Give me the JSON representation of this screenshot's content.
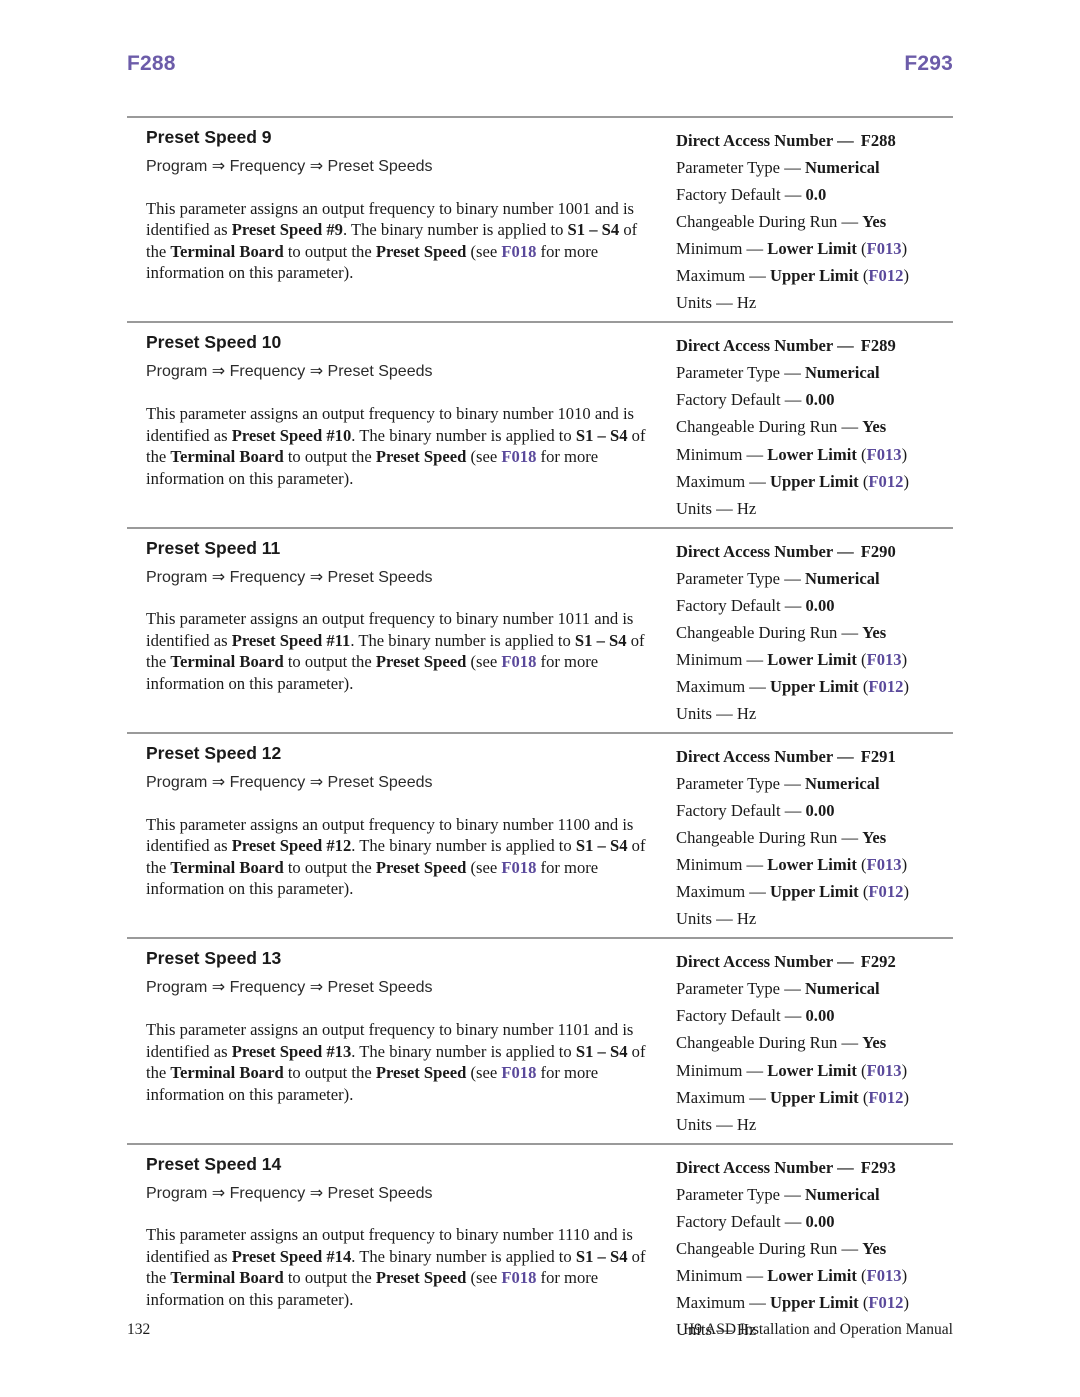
{
  "running_head": {
    "left": "F288",
    "right": "F293",
    "color": "#6c5ca9"
  },
  "accent_colors": {
    "running_head_purple": "#6c5ca9",
    "cross_reference_purple": "#5a499b",
    "rule_gray": "#9a9a9a"
  },
  "parameters": [
    {
      "title": "Preset Speed 9",
      "breadcrumb": "Program ⇒ Frequency ⇒ Preset Speeds",
      "desc_parts": [
        {
          "t": "This parameter assigns an output frequency to binary number 1001 and is identified as ",
          "s": "n"
        },
        {
          "t": "Preset Speed #9",
          "s": "b"
        },
        {
          "t": ". The binary number is applied to ",
          "s": "n"
        },
        {
          "t": "S1 – S4",
          "s": "b"
        },
        {
          "t": " of the ",
          "s": "n"
        },
        {
          "t": "Terminal Board",
          "s": "b"
        },
        {
          "t": " to output the ",
          "s": "n"
        },
        {
          "t": "Preset Speed",
          "s": "b"
        },
        {
          "t": " (see ",
          "s": "n"
        },
        {
          "t": "F018",
          "s": "r"
        },
        {
          "t": " for more information on this parameter).",
          "s": "n"
        }
      ],
      "specs": [
        {
          "label": "Direct Access Number —",
          "value": "F288",
          "bold_all": true,
          "gap": true
        },
        {
          "label": "Parameter Type —",
          "value": "Numerical"
        },
        {
          "label": "Factory Default —",
          "value": "0.0"
        },
        {
          "label": "Changeable During Run —",
          "value": "Yes"
        },
        {
          "label": "Minimum —",
          "value": "Lower Limit",
          "xref": "F013"
        },
        {
          "label": "Maximum —",
          "value": "Upper Limit",
          "xref": "F012"
        },
        {
          "label": "Units — Hz",
          "value": ""
        }
      ]
    },
    {
      "title": "Preset Speed 10",
      "breadcrumb": "Program ⇒ Frequency ⇒ Preset Speeds",
      "desc_parts": [
        {
          "t": "This parameter assigns an output frequency to binary number 1010 and is identified as ",
          "s": "n"
        },
        {
          "t": "Preset Speed #10",
          "s": "b"
        },
        {
          "t": ". The binary number is applied to ",
          "s": "n"
        },
        {
          "t": "S1 – S4",
          "s": "b"
        },
        {
          "t": " of the ",
          "s": "n"
        },
        {
          "t": "Terminal Board",
          "s": "b"
        },
        {
          "t": " to output the ",
          "s": "n"
        },
        {
          "t": "Preset Speed",
          "s": "b"
        },
        {
          "t": " (see ",
          "s": "n"
        },
        {
          "t": "F018",
          "s": "r"
        },
        {
          "t": " for more information on this parameter).",
          "s": "n"
        }
      ],
      "specs": [
        {
          "label": "Direct Access Number —",
          "value": "F289",
          "bold_all": true,
          "gap": true
        },
        {
          "label": "Parameter Type —",
          "value": "Numerical"
        },
        {
          "label": "Factory Default —",
          "value": "0.00"
        },
        {
          "label": "Changeable During Run —",
          "value": "Yes"
        },
        {
          "label": "Minimum —",
          "value": "Lower Limit",
          "xref": "F013"
        },
        {
          "label": "Maximum —",
          "value": "Upper Limit",
          "xref": "F012"
        },
        {
          "label": "Units — Hz",
          "value": ""
        }
      ]
    },
    {
      "title": "Preset Speed 11",
      "breadcrumb": "Program ⇒ Frequency ⇒ Preset Speeds",
      "desc_parts": [
        {
          "t": "This parameter assigns an output frequency to binary number 1011 and is identified as ",
          "s": "n"
        },
        {
          "t": "Preset Speed #11",
          "s": "b"
        },
        {
          "t": ". The binary number is applied to ",
          "s": "n"
        },
        {
          "t": "S1 – S4",
          "s": "b"
        },
        {
          "t": " of the ",
          "s": "n"
        },
        {
          "t": "Terminal Board",
          "s": "b"
        },
        {
          "t": " to output the ",
          "s": "n"
        },
        {
          "t": "Preset Speed",
          "s": "b"
        },
        {
          "t": " (see ",
          "s": "n"
        },
        {
          "t": "F018",
          "s": "r"
        },
        {
          "t": " for more information on this parameter).",
          "s": "n"
        }
      ],
      "specs": [
        {
          "label": "Direct Access Number —",
          "value": "F290",
          "bold_all": true,
          "gap": true
        },
        {
          "label": "Parameter Type —",
          "value": "Numerical"
        },
        {
          "label": "Factory Default —",
          "value": "0.00"
        },
        {
          "label": "Changeable During Run —",
          "value": "Yes"
        },
        {
          "label": "Minimum —",
          "value": "Lower Limit",
          "xref": "F013"
        },
        {
          "label": "Maximum —",
          "value": "Upper Limit",
          "xref": "F012"
        },
        {
          "label": "Units — Hz",
          "value": ""
        }
      ]
    },
    {
      "title": "Preset Speed 12",
      "breadcrumb": "Program ⇒ Frequency ⇒ Preset Speeds",
      "desc_parts": [
        {
          "t": "This parameter assigns an output frequency to binary number 1100 and is identified as ",
          "s": "n"
        },
        {
          "t": "Preset Speed #12",
          "s": "b"
        },
        {
          "t": ". The binary number is applied to ",
          "s": "n"
        },
        {
          "t": "S1 – S4",
          "s": "b"
        },
        {
          "t": " of the ",
          "s": "n"
        },
        {
          "t": "Terminal Board",
          "s": "b"
        },
        {
          "t": " to output the ",
          "s": "n"
        },
        {
          "t": "Preset Speed",
          "s": "b"
        },
        {
          "t": " (see ",
          "s": "n"
        },
        {
          "t": "F018",
          "s": "r"
        },
        {
          "t": " for more information on this parameter).",
          "s": "n"
        }
      ],
      "specs": [
        {
          "label": "Direct Access Number —",
          "value": "F291",
          "bold_all": true,
          "gap": true
        },
        {
          "label": "Parameter Type —",
          "value": "Numerical"
        },
        {
          "label": "Factory Default —",
          "value": "0.00"
        },
        {
          "label": "Changeable During Run —",
          "value": "Yes"
        },
        {
          "label": "Minimum —",
          "value": "Lower Limit",
          "xref": "F013"
        },
        {
          "label": "Maximum —",
          "value": "Upper Limit",
          "xref": "F012"
        },
        {
          "label": "Units — Hz",
          "value": ""
        }
      ]
    },
    {
      "title": "Preset Speed 13",
      "breadcrumb": "Program ⇒ Frequency ⇒ Preset Speeds",
      "desc_parts": [
        {
          "t": "This parameter assigns an output frequency to binary number 1101 and is identified as ",
          "s": "n"
        },
        {
          "t": "Preset Speed #13",
          "s": "b"
        },
        {
          "t": ". The binary number is applied to ",
          "s": "n"
        },
        {
          "t": "S1 – S4",
          "s": "b"
        },
        {
          "t": " of the ",
          "s": "n"
        },
        {
          "t": "Terminal Board",
          "s": "b"
        },
        {
          "t": " to output the ",
          "s": "n"
        },
        {
          "t": "Preset Speed",
          "s": "b"
        },
        {
          "t": " (see ",
          "s": "n"
        },
        {
          "t": "F018",
          "s": "r"
        },
        {
          "t": " for more information on this parameter).",
          "s": "n"
        }
      ],
      "specs": [
        {
          "label": "Direct Access Number —",
          "value": "F292",
          "bold_all": true,
          "gap": true
        },
        {
          "label": "Parameter Type —",
          "value": "Numerical"
        },
        {
          "label": "Factory Default —",
          "value": "0.00"
        },
        {
          "label": "Changeable During Run —",
          "value": "Yes"
        },
        {
          "label": "Minimum —",
          "value": "Lower Limit",
          "xref": "F013"
        },
        {
          "label": "Maximum —",
          "value": "Upper Limit",
          "xref": "F012"
        },
        {
          "label": "Units — Hz",
          "value": ""
        }
      ]
    },
    {
      "title": "Preset Speed 14",
      "breadcrumb": "Program ⇒ Frequency ⇒ Preset Speeds",
      "desc_parts": [
        {
          "t": "This parameter assigns an output frequency to binary number 1110 and is identified as ",
          "s": "n"
        },
        {
          "t": "Preset Speed #14",
          "s": "b"
        },
        {
          "t": ". The binary number is applied to ",
          "s": "n"
        },
        {
          "t": "S1 – S4",
          "s": "b"
        },
        {
          "t": " of the ",
          "s": "n"
        },
        {
          "t": "Terminal Board",
          "s": "b"
        },
        {
          "t": " to output the ",
          "s": "n"
        },
        {
          "t": "Preset Speed",
          "s": "b"
        },
        {
          "t": " (see ",
          "s": "n"
        },
        {
          "t": "F018",
          "s": "r"
        },
        {
          "t": " for more information on this parameter).",
          "s": "n"
        }
      ],
      "specs": [
        {
          "label": "Direct Access Number —",
          "value": "F293",
          "bold_all": true,
          "gap": true
        },
        {
          "label": "Parameter Type —",
          "value": "Numerical"
        },
        {
          "label": "Factory Default —",
          "value": "0.00"
        },
        {
          "label": "Changeable During Run —",
          "value": "Yes"
        },
        {
          "label": "Minimum —",
          "value": "Lower Limit",
          "xref": "F013"
        },
        {
          "label": "Maximum —",
          "value": "Upper Limit",
          "xref": "F012"
        },
        {
          "label": "Units — Hz",
          "value": ""
        }
      ]
    }
  ],
  "footer": {
    "page_number": "132",
    "manual_title": "H9 ASD Installation and Operation Manual"
  }
}
